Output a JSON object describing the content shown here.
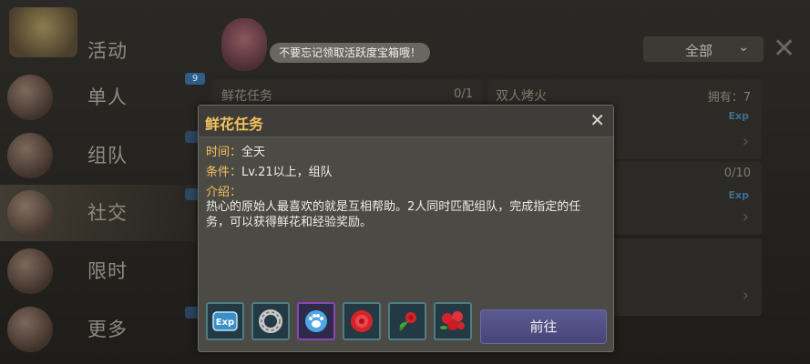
{
  "sidebar": {
    "items": [
      {
        "label": "活动"
      },
      {
        "label": "单人"
      },
      {
        "label": "组队"
      },
      {
        "label": "社交"
      },
      {
        "label": "限时"
      },
      {
        "label": "更多"
      }
    ],
    "badge_single": "9"
  },
  "banner": {
    "tip": "不要忘记领取活跃度宝箱哦！"
  },
  "filter": {
    "label": "全部"
  },
  "background_tasks": [
    {
      "title": "鲜花任务",
      "count": "0/1"
    },
    {
      "title": "双人烤火",
      "count": "拥有：7"
    },
    {
      "count": "0/10"
    }
  ],
  "dialog": {
    "title": "鲜花任务",
    "time_key": "时间：",
    "time_val": "全天",
    "cond_key": "条件：",
    "cond_val": "Lv.21以上，组队",
    "intro_key": "介绍：",
    "description": "热心的原始人最喜欢的就是互相帮助。2人同时匹配组队，完成指定的任务，可以获得鲜花和经验奖励。",
    "rewards": [
      {
        "icon": "exp-icon"
      },
      {
        "icon": "ring-icon"
      },
      {
        "icon": "paw-icon"
      },
      {
        "icon": "red-rose-icon"
      },
      {
        "icon": "single-rose-icon"
      },
      {
        "icon": "rose-bouquet-icon"
      }
    ],
    "go_label": "前往",
    "exp_label": "Exp"
  },
  "colors": {
    "title_gold": "#f3c35c",
    "button_purple": "#5c5a93",
    "rare_border": "#8b45b5"
  }
}
